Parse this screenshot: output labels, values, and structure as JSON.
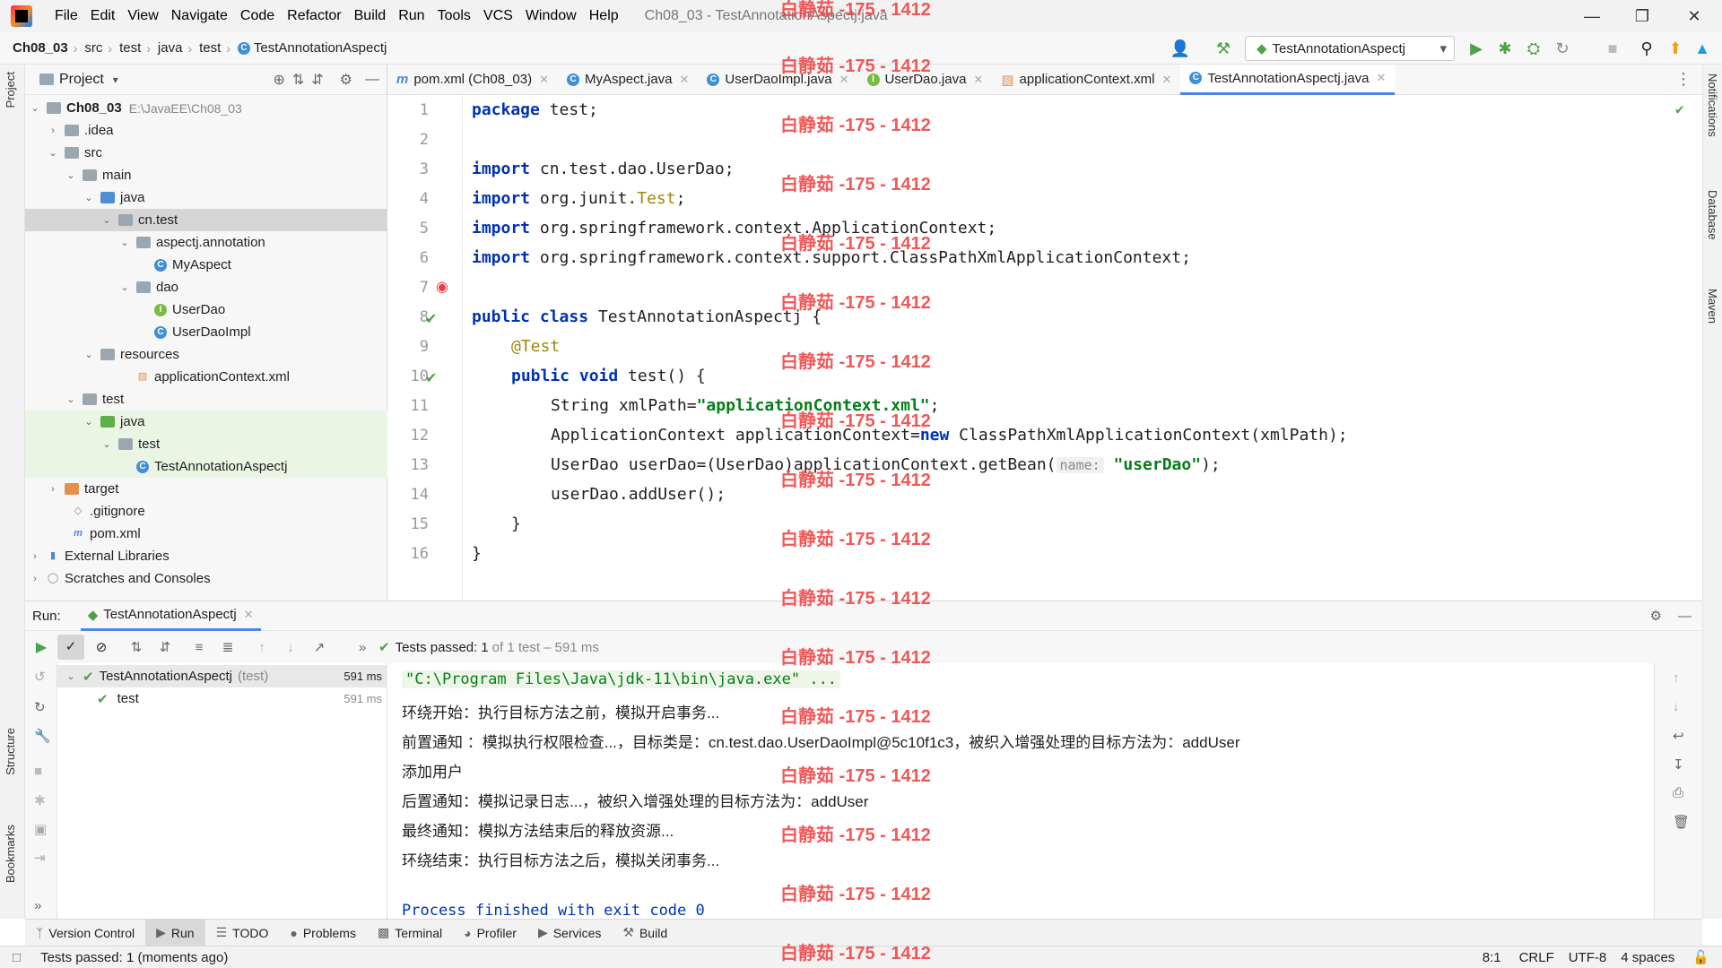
{
  "titlebar": {
    "menu": [
      "File",
      "Edit",
      "View",
      "Navigate",
      "Code",
      "Refactor",
      "Build",
      "Run",
      "Tools",
      "VCS",
      "Window",
      "Help"
    ],
    "window_title": "Ch08_03 - TestAnnotationAspectj.java"
  },
  "navbar": {
    "breadcrumbs": [
      "Ch08_03",
      "src",
      "test",
      "java",
      "test",
      "TestAnnotationAspectj"
    ],
    "run_config": "TestAnnotationAspectj"
  },
  "left_strip": {
    "project_tab": "Project",
    "structure_tab": "Structure",
    "bookmarks_tab": "Bookmarks"
  },
  "right_strip": {
    "tabs": [
      "Notifications",
      "Database",
      "Maven"
    ]
  },
  "project_panel": {
    "title": "Project",
    "root_path": "E:\\JavaEE\\Ch08_03",
    "items": [
      "Ch08_03",
      ".idea",
      "src",
      "main",
      "java",
      "cn.test",
      "aspectj.annotation",
      "MyAspect",
      "dao",
      "UserDao",
      "UserDaoImpl",
      "resources",
      "applicationContext.xml",
      "test",
      "java",
      "test",
      "TestAnnotationAspectj",
      "target",
      ".gitignore",
      "pom.xml",
      "External Libraries",
      "Scratches and Consoles"
    ]
  },
  "editor": {
    "tabs": [
      "pom.xml (Ch08_03)",
      "MyAspect.java",
      "UserDaoImpl.java",
      "UserDao.java",
      "applicationContext.xml",
      "TestAnnotationAspectj.java"
    ],
    "line_numbers": [
      "1",
      "2",
      "3",
      "4",
      "5",
      "6",
      "7",
      "8",
      "9",
      "10",
      "11",
      "12",
      "13",
      "14",
      "15",
      "16"
    ],
    "code": {
      "l1_kw": "package",
      "l1_rest": " test;",
      "l3_kw": "import",
      "l3_rest": " cn.test.dao.UserDao;",
      "l4_kw": "import",
      "l4_rest": " org.junit.",
      "l4_ann": "Test",
      "l4_end": ";",
      "l5_kw": "import",
      "l5_rest": " org.springframework.context.ApplicationContext;",
      "l6_kw": "import",
      "l6_rest": " org.springframework.context.support.ClassPathXmlApplicationContext;",
      "l8_kw": "public class",
      "l8_rest": " TestAnnotationAspectj {",
      "l9_ann": "@Test",
      "l10_kw": "public void",
      "l10_rest": " test() {",
      "l11_a": "String xmlPath=",
      "l11_str": "\"applicationContext.xml\"",
      "l11_end": ";",
      "l12_a": "ApplicationContext applicationContext=",
      "l12_kw": "new",
      "l12_rest": " ClassPathXmlApplicationContext(xmlPath);",
      "l13_a": "UserDao userDao=(UserDao)applicationContext.getBean(",
      "l13_hint": "name:",
      "l13_str": "\"userDao\"",
      "l13_end": ");",
      "l14": "userDao.addUser();",
      "l15": "}",
      "l16": "}"
    }
  },
  "run_panel": {
    "label": "Run:",
    "tab": "TestAnnotationAspectj",
    "status_passed": "Tests passed:",
    "status_count": "1",
    "status_rest": "of 1 test – 591 ms",
    "tree": [
      {
        "name": "TestAnnotationAspectj",
        "suffix": "(test)",
        "time": "591 ms"
      },
      {
        "name": "test",
        "time": "591 ms"
      }
    ],
    "console": [
      "\"C:\\Program Files\\Java\\jdk-11\\bin\\java.exe\" ...",
      "环绕开始：执行目标方法之前，模拟开启事务...",
      "前置通知 ：模拟执行权限检查...，目标类是：cn.test.dao.UserDaoImpl@5c10f1c3，被织入增强处理的目标方法为：addUser",
      "添加用户",
      "后置通知：模拟记录日志...，被织入增强处理的目标方法为：addUser",
      "最终通知：模拟方法结束后的释放资源...",
      "环绕结束：执行目标方法之后，模拟关闭事务...",
      "Process finished with exit code 0"
    ]
  },
  "tool_tabs": [
    "Version Control",
    "Run",
    "TODO",
    "Problems",
    "Terminal",
    "Profiler",
    "Services",
    "Build"
  ],
  "status_bar": {
    "message": "Tests passed: 1 (moments ago)",
    "position": "8:1",
    "line_sep": "CRLF",
    "encoding": "UTF-8",
    "indent": "4 spaces"
  },
  "watermark": "白静茹 -175 - 1412",
  "colors": {
    "keyword": "#0033b3",
    "string": "#067d17",
    "annotation": "#9e880d",
    "accent": "#4a86e8",
    "pass": "#4ea04a"
  }
}
